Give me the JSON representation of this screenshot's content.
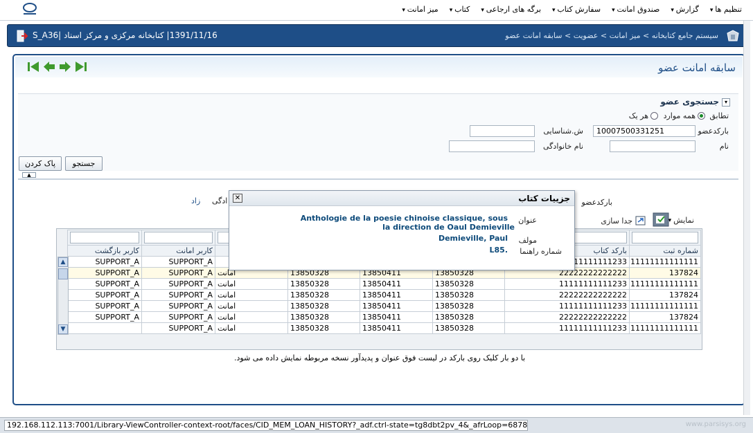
{
  "menubar": {
    "items": [
      "میز امانت",
      "کتاب",
      "برگه های ارجاعی",
      "سفارش کتاب",
      "صندوق امانت",
      "گزارش",
      "تنظیم ها"
    ]
  },
  "header": {
    "breadcrumb_root": "سیستم جامع کتابخانه",
    "breadcrumb_2": "میز امانت",
    "breadcrumb_3": "عضویت",
    "breadcrumb_4": "سابقه امانت عضو",
    "separator": ">",
    "info": "1391/11/16| کتابخانه مرکزی و مرکز اسناد |S_A36"
  },
  "page": {
    "title": "سابقه امانت عضو"
  },
  "search": {
    "title": "جستجوی عضو",
    "match_label": "تطابق",
    "match_all": "همه موارد",
    "match_any": "هر یک",
    "barcode_label": "بارکدعضو",
    "barcode_value": "10007500331251",
    "id_label": "ش.شناسایی",
    "id_value": "",
    "name_label": "نام",
    "name_value": "",
    "family_label": "نام خانوادگی",
    "family_value": "",
    "search_button": "جستجو",
    "clear_button": "پاک کردن"
  },
  "results": {
    "barcode_label": "بارکدعضو",
    "family_partial": "ادگی",
    "family_value_partial": "زاد",
    "view_menu": "نمایش",
    "detach_label": "جدا سازی",
    "columns": [
      "شماره ثبت",
      "بارکد کتاب",
      "",
      "",
      "",
      "",
      "کاربر امانت",
      "کاربر بازگشت"
    ],
    "rows": [
      [
        "11111111111111",
        "11111111111233",
        "",
        "",
        "",
        "",
        "SUPPORT_A",
        "SUPPORT_A"
      ],
      [
        "137824",
        "22222222222222",
        "13850328",
        "13850411",
        "13850328",
        "امانت",
        "SUPPORT_A",
        "SUPPORT_A"
      ],
      [
        "11111111111111",
        "11111111111233",
        "13850328",
        "13850411",
        "13850328",
        "امانت",
        "SUPPORT_A",
        "SUPPORT_A"
      ],
      [
        "137824",
        "22222222222222",
        "13850328",
        "13850411",
        "13850328",
        "امانت",
        "SUPPORT_A",
        "SUPPORT_A"
      ],
      [
        "11111111111111",
        "11111111111233",
        "13850328",
        "13850411",
        "13850328",
        "امانت",
        "SUPPORT_A",
        "SUPPORT_A"
      ],
      [
        "137824",
        "22222222222222",
        "13850328",
        "13850411",
        "13850328",
        "امانت",
        "SUPPORT_A",
        "SUPPORT_A"
      ],
      [
        "11111111111111",
        "11111111111233",
        "13850328",
        "13850411",
        "13850328",
        "امانت",
        "SUPPORT_A",
        ""
      ]
    ],
    "hint": "با دو بار کلیک روی بارکد در لیست فوق عنوان و پدیدآور نسخه مربوطه نمایش داده می شود."
  },
  "popup": {
    "title": "جزییات کتاب",
    "title_label": "عنوان",
    "title_value_1": "Anthologie de la poesie chinoise classique, sous",
    "title_value_2": "la direction de Oaul Demieville",
    "author_label": "مولف",
    "author_value": "Demieville, Paul",
    "callno_label": "شماره راهنما",
    "callno_value": "L85."
  },
  "statusbar": {
    "url": "192.168.112.113:7001/Library-ViewController-context-root/faces/CID_MEM_LOAN_HISTORY?_adf.ctrl-state=tg8dbt2pv_4&_afrLoop=687886143785692#",
    "watermark": "www.parsisys.org"
  },
  "colors": {
    "header_bg": "#1e4e87",
    "accent": "#1e4e87",
    "nav_green": "#3f9a2e"
  }
}
